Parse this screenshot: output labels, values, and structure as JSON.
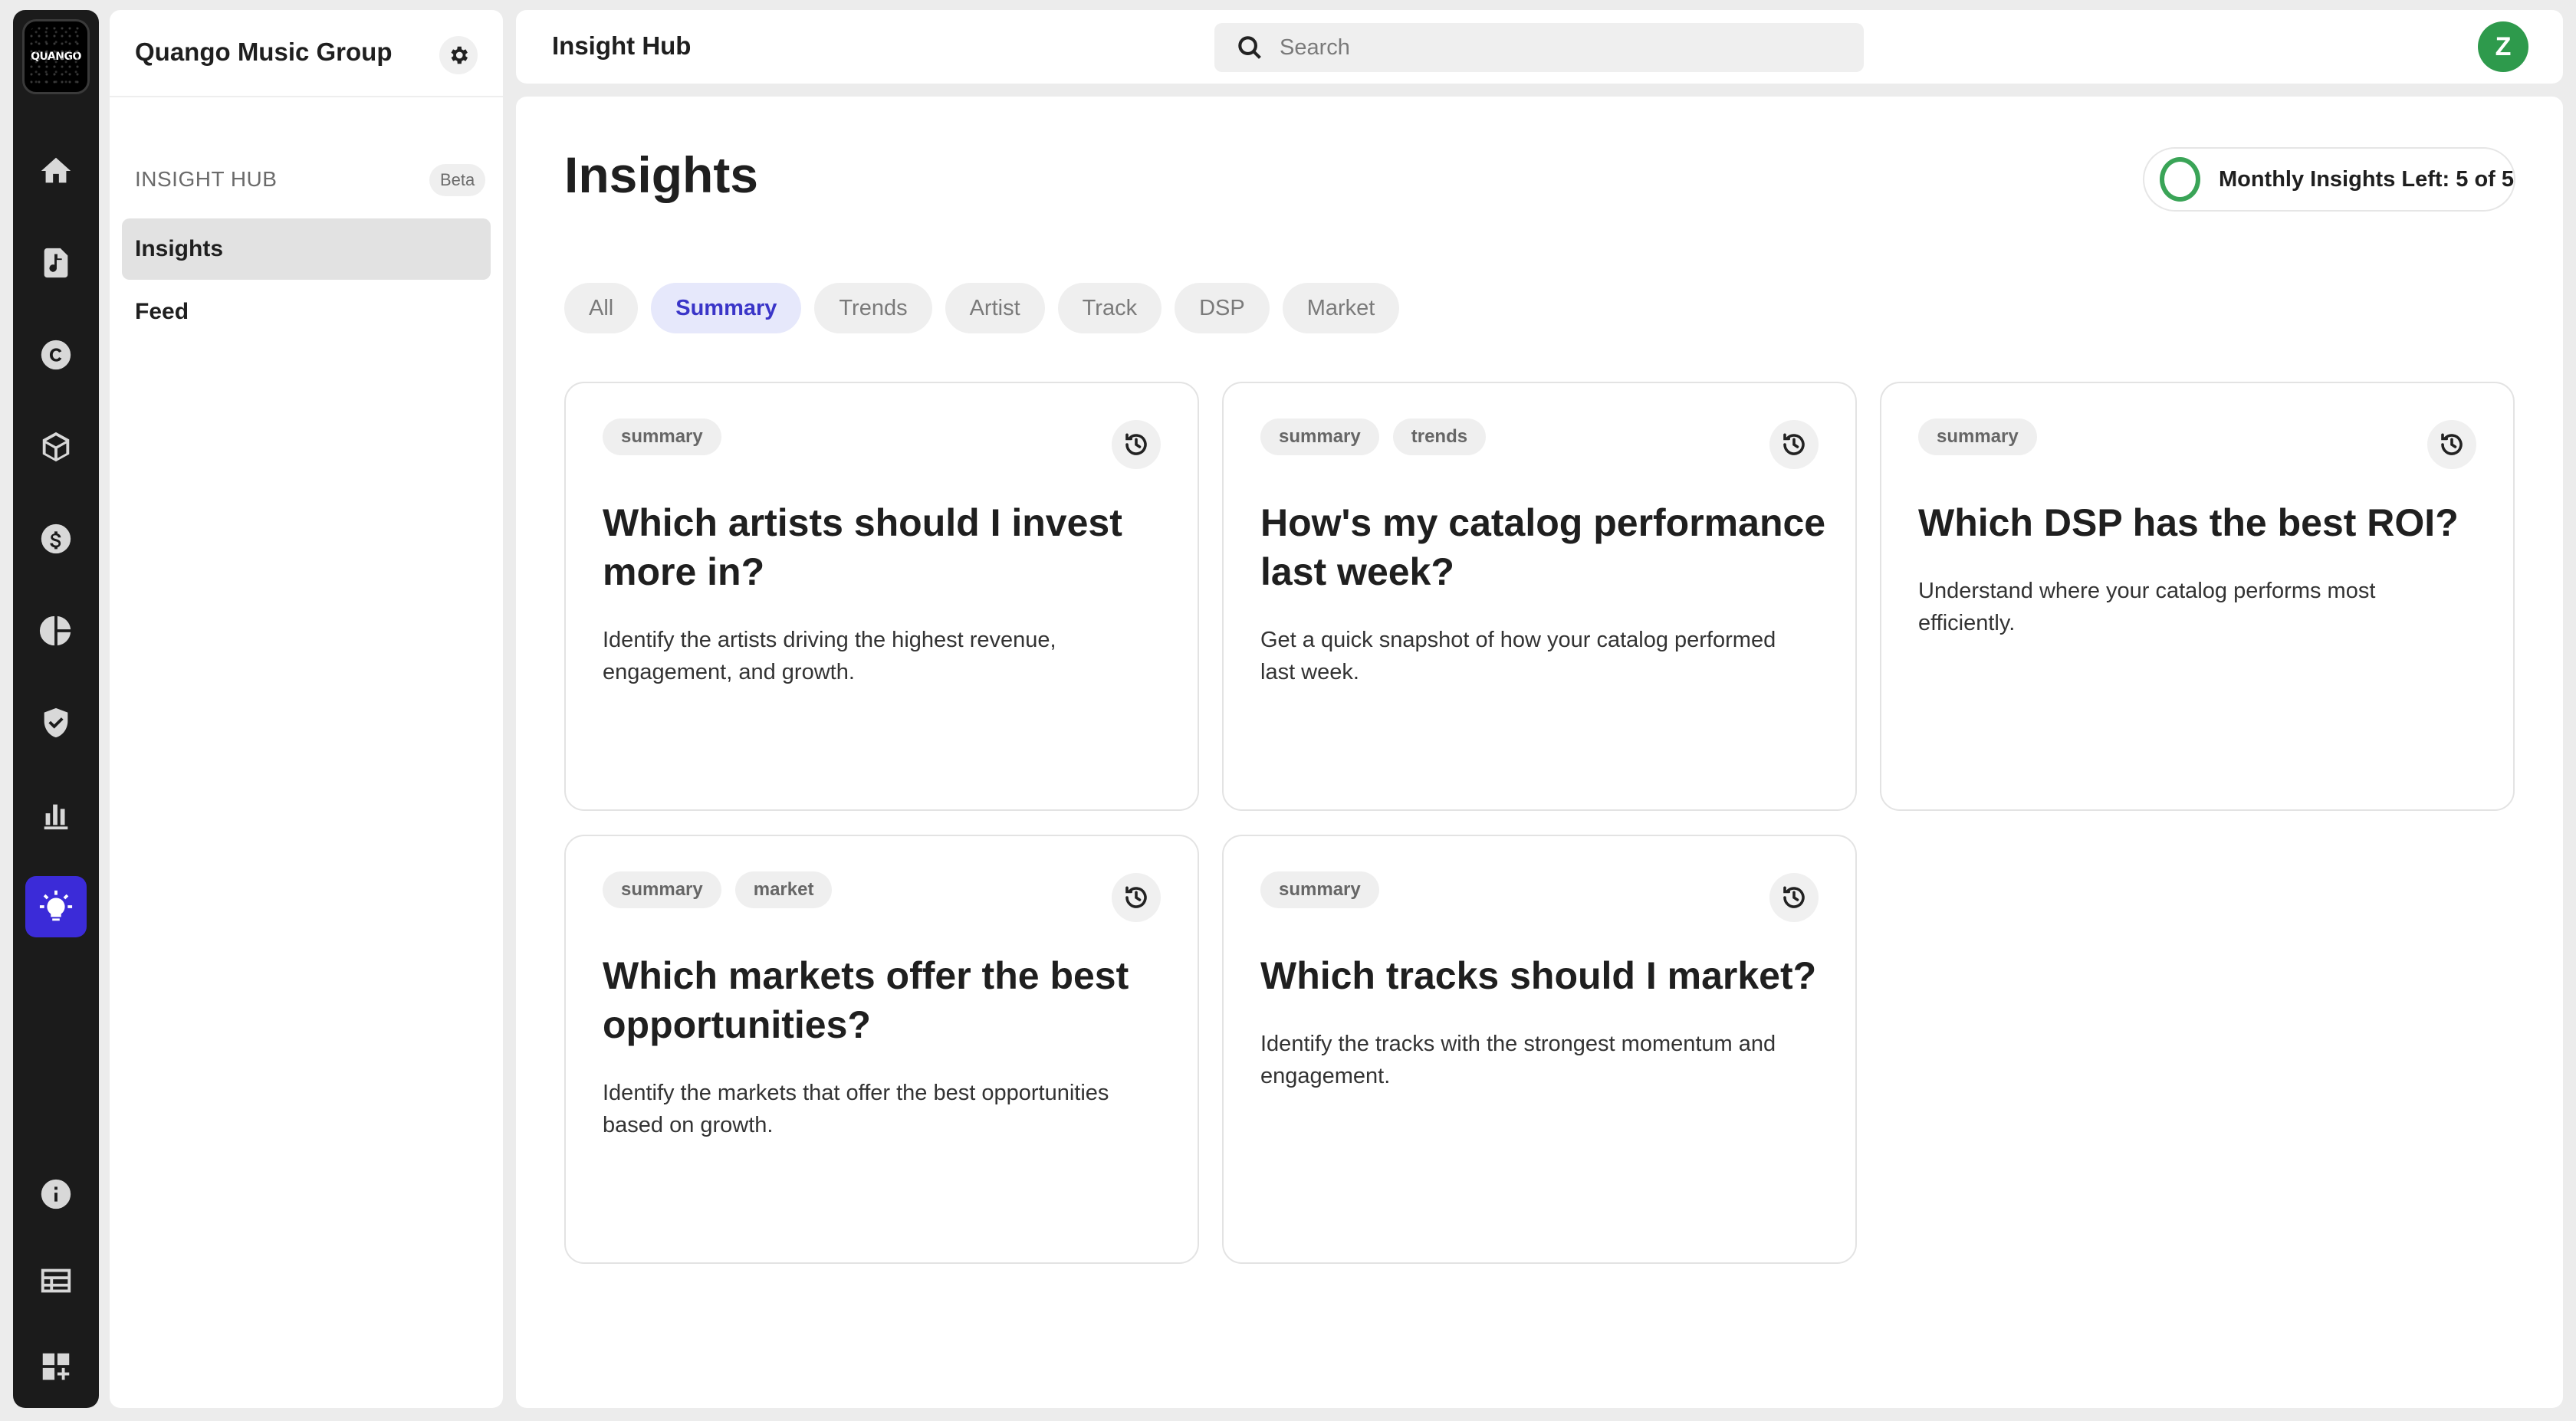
{
  "rail": {
    "logo_text": "QUANGO",
    "items": [
      "home",
      "music-catalog",
      "copyright",
      "products",
      "revenue",
      "analytics-pie",
      "protection",
      "charts",
      "insights"
    ],
    "bottom_items": [
      "info",
      "table",
      "apps"
    ],
    "active_color": "#3b2bd8"
  },
  "sidebar": {
    "org_name": "Quango Music Group",
    "section_label": "INSIGHT HUB",
    "section_badge": "Beta",
    "items": [
      {
        "label": "Insights",
        "active": true
      },
      {
        "label": "Feed",
        "active": false
      }
    ]
  },
  "header": {
    "title": "Insight Hub",
    "search_placeholder": "Search",
    "avatar_initial": "Z",
    "avatar_color": "#2e9a4c"
  },
  "main": {
    "page_title": "Insights",
    "quota_label": "Monthly Insights Left: 5 of 5",
    "quota_color": "#3aa457",
    "filters": [
      {
        "label": "All",
        "active": false
      },
      {
        "label": "Summary",
        "active": true
      },
      {
        "label": "Trends",
        "active": false
      },
      {
        "label": "Artist",
        "active": false
      },
      {
        "label": "Track",
        "active": false
      },
      {
        "label": "DSP",
        "active": false
      },
      {
        "label": "Market",
        "active": false
      }
    ],
    "cards": [
      {
        "tags": [
          "summary"
        ],
        "question": "Which artists should I invest more in?",
        "description": "Identify the artists driving the highest revenue, engagement, and growth."
      },
      {
        "tags": [
          "summary",
          "trends"
        ],
        "question": "How's my catalog performance last week?",
        "description": "Get a quick snapshot of how your catalog performed last week."
      },
      {
        "tags": [
          "summary"
        ],
        "question": "Which DSP has the best ROI?",
        "description": "Understand where your catalog performs most efficiently."
      },
      {
        "tags": [
          "summary",
          "market"
        ],
        "question": "Which markets offer the best opportunities?",
        "description": "Identify the markets that offer the best opportunities based on growth."
      },
      {
        "tags": [
          "summary"
        ],
        "question": "Which tracks should I market?",
        "description": "Identify the tracks with the strongest momentum and engagement."
      }
    ]
  }
}
